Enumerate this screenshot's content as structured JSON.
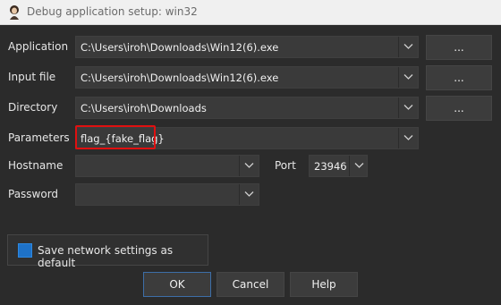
{
  "window": {
    "title": "Debug application setup: win32",
    "icon": "app-logo-icon"
  },
  "fields": {
    "application": {
      "label": "Application",
      "value": "C:\\Users\\iroh\\Downloads\\Win12(6).exe",
      "browse": "..."
    },
    "input_file": {
      "label": "Input file",
      "value": "C:\\Users\\iroh\\Downloads\\Win12(6).exe",
      "browse": "..."
    },
    "directory": {
      "label": "Directory",
      "value": "C:\\Users\\iroh\\Downloads",
      "browse": "..."
    },
    "parameters": {
      "label": "Parameters",
      "value": "flag_{fake_flag}"
    },
    "hostname": {
      "label": "Hostname",
      "value": ""
    },
    "port": {
      "label": "Port",
      "value": "23946"
    },
    "password": {
      "label": "Password",
      "value": ""
    }
  },
  "save_settings": {
    "label": "Save network settings as default",
    "checked": true
  },
  "buttons": {
    "ok": "OK",
    "cancel": "Cancel",
    "help": "Help"
  },
  "colors": {
    "background": "#2b2b2b",
    "highlight": "#e01010",
    "checkbox": "#1e72c8"
  }
}
